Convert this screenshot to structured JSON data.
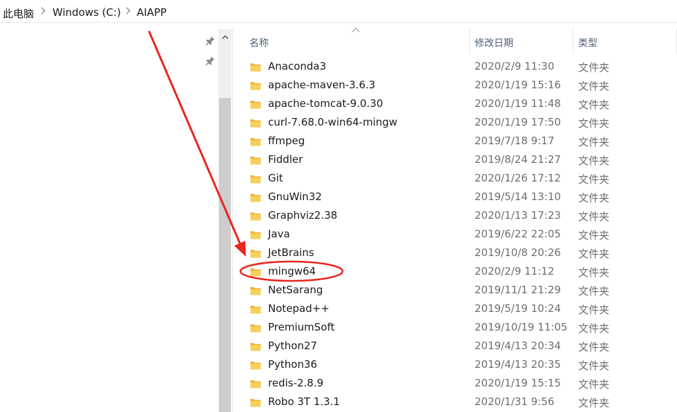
{
  "breadcrumb": [
    "此电脑",
    "Windows (C:)",
    "AIAPP"
  ],
  "columns": {
    "name": "名称",
    "modified": "修改日期",
    "type": "类型"
  },
  "files": [
    {
      "name": "Anaconda3",
      "modified": "2020/2/9 11:30",
      "type": "文件夹"
    },
    {
      "name": "apache-maven-3.6.3",
      "modified": "2020/1/19 15:16",
      "type": "文件夹"
    },
    {
      "name": "apache-tomcat-9.0.30",
      "modified": "2020/1/19 11:48",
      "type": "文件夹"
    },
    {
      "name": "curl-7.68.0-win64-mingw",
      "modified": "2020/1/19 17:50",
      "type": "文件夹"
    },
    {
      "name": "ffmpeg",
      "modified": "2019/7/18 9:17",
      "type": "文件夹"
    },
    {
      "name": "Fiddler",
      "modified": "2019/8/24 21:27",
      "type": "文件夹"
    },
    {
      "name": "Git",
      "modified": "2020/1/26 17:12",
      "type": "文件夹"
    },
    {
      "name": "GnuWin32",
      "modified": "2019/5/14 13:10",
      "type": "文件夹"
    },
    {
      "name": "Graphviz2.38",
      "modified": "2020/1/13 17:23",
      "type": "文件夹"
    },
    {
      "name": "Java",
      "modified": "2019/6/22 22:05",
      "type": "文件夹"
    },
    {
      "name": "JetBrains",
      "modified": "2019/10/8 20:26",
      "type": "文件夹"
    },
    {
      "name": "mingw64",
      "modified": "2020/2/9 11:12",
      "type": "文件夹"
    },
    {
      "name": "NetSarang",
      "modified": "2019/11/1 21:29",
      "type": "文件夹"
    },
    {
      "name": "Notepad++",
      "modified": "2019/5/19 10:24",
      "type": "文件夹"
    },
    {
      "name": "PremiumSoft",
      "modified": "2019/10/19 11:05",
      "type": "文件夹"
    },
    {
      "name": "Python27",
      "modified": "2019/4/13 20:34",
      "type": "文件夹"
    },
    {
      "name": "Python36",
      "modified": "2019/4/13 20:35",
      "type": "文件夹"
    },
    {
      "name": "redis-2.8.9",
      "modified": "2020/1/19 15:15",
      "type": "文件夹"
    },
    {
      "name": "Robo 3T 1.3.1",
      "modified": "2020/1/31 9:56",
      "type": "文件夹"
    }
  ],
  "icons": {
    "pin": "pin-icon",
    "folder": "folder-icon",
    "scroll_up": "chevron-up-icon",
    "breadcrumb_separator": "chevron-right-icon"
  },
  "colors": {
    "annotation": "#e8261e",
    "folder": "#f4c542",
    "header_text": "#4c607a"
  },
  "annotation": {
    "highlighted_item": "mingw64"
  }
}
